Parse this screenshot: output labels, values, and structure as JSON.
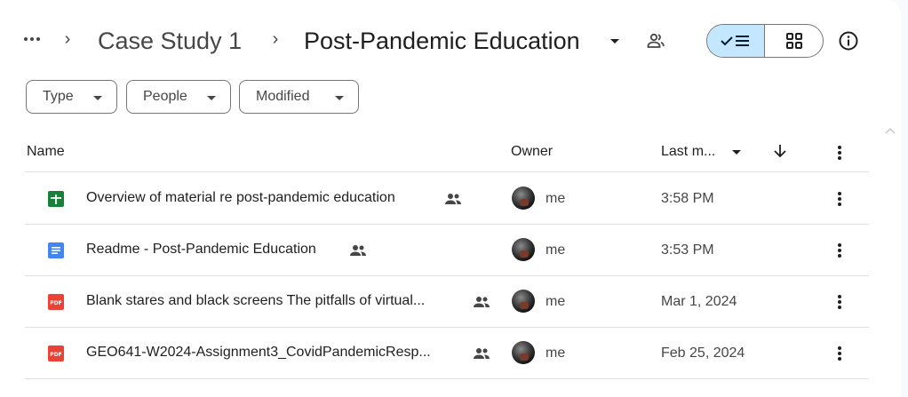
{
  "breadcrumb": {
    "parent": "Case Study 1",
    "current": "Post-Pandemic Education"
  },
  "filters": [
    {
      "label": "Type"
    },
    {
      "label": "People"
    },
    {
      "label": "Modified"
    }
  ],
  "table": {
    "headers": {
      "name": "Name",
      "owner": "Owner",
      "last_modified": "Last m..."
    },
    "rows": [
      {
        "icon": "sheets-icon",
        "name": "Overview of material re post-pandemic education",
        "owner": "me",
        "modified": "3:58 PM"
      },
      {
        "icon": "docs-icon",
        "name": "Readme - Post-Pandemic Education",
        "owner": "me",
        "modified": "3:53 PM"
      },
      {
        "icon": "pdf-icon",
        "name": "Blank stares and black screens The pitfalls of virtual...",
        "owner": "me",
        "modified": "Mar 1, 2024"
      },
      {
        "icon": "pdf-icon",
        "name": "GEO641-W2024-Assignment3_CovidPandemicResp...",
        "owner": "me",
        "modified": "Feb 25, 2024"
      }
    ]
  },
  "colors": {
    "sheets": "#188038",
    "docs": "#4285f4",
    "pdf": "#ea4335",
    "view_toggle_active": "#c2e7ff"
  }
}
